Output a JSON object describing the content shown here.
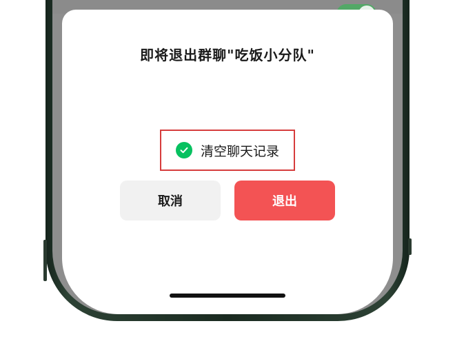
{
  "dialog": {
    "title": "即将退出群聊\"吃饭小分队\"",
    "option_label": "清空聊天记录",
    "option_checked": true,
    "cancel_label": "取消",
    "exit_label": "退出"
  },
  "colors": {
    "check_green": "#07c160",
    "exit_red": "#f35354",
    "highlight_border": "#d63c3c",
    "toggle_green": "#53a867"
  },
  "icons": {
    "check": "check-circle-icon"
  }
}
